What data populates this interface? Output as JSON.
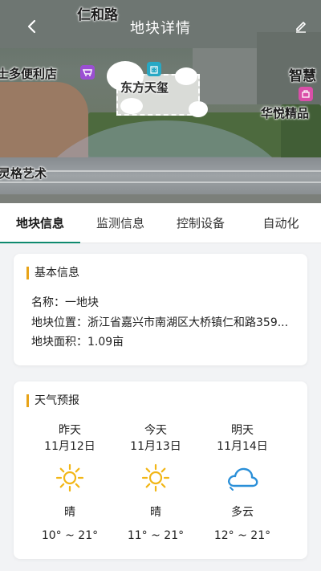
{
  "header": {
    "title": "地块详情",
    "map_labels": {
      "road": "仁和路",
      "store": "士多便利店",
      "center": "东方天玺",
      "right_top": "智慧",
      "right_shop": "华悦精品",
      "left_bottom": "灵格艺术"
    }
  },
  "tabs": [
    {
      "label": "地块信息",
      "active": true
    },
    {
      "label": "监测信息",
      "active": false
    },
    {
      "label": "控制设备",
      "active": false
    },
    {
      "label": "自动化",
      "active": false
    }
  ],
  "basic_info": {
    "title": "基本信息",
    "name": "名称：一地块",
    "location": "地块位置：浙江省嘉兴市南湖区大桥镇仁和路359...",
    "area": "地块面积：1.09亩"
  },
  "weather": {
    "title": "天气预报",
    "days": [
      {
        "day": "昨天",
        "date": "11月12日",
        "icon": "sun-icon",
        "cond": "晴",
        "temp": "10° ~ 21°"
      },
      {
        "day": "今天",
        "date": "11月13日",
        "icon": "sun-icon",
        "cond": "晴",
        "temp": "11° ~ 21°"
      },
      {
        "day": "明天",
        "date": "11月14日",
        "icon": "cloud-icon",
        "cond": "多云",
        "temp": "12° ~ 21°"
      }
    ]
  },
  "colors": {
    "accent": "#0f8a6f",
    "title_bar": "#e8a317",
    "sun": "#f2b616",
    "cloud": "#2a8fd8"
  }
}
